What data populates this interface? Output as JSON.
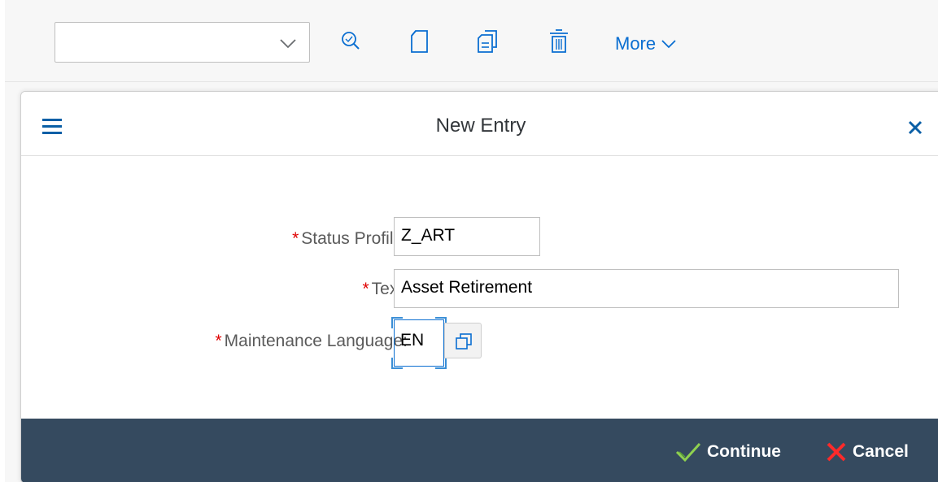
{
  "toolbar": {
    "combo_value": "",
    "more_label": "More",
    "icons": [
      "search-icon",
      "new-document-icon",
      "copy-icon",
      "delete-icon"
    ]
  },
  "dialog": {
    "title": "New Entry",
    "fields": {
      "status_profile": {
        "label": "Status Profile:",
        "value": "Z_ART",
        "required": "*"
      },
      "text": {
        "label": "Text:",
        "value": "Asset Retirement",
        "required": "*"
      },
      "maintenance_language": {
        "label": "Maintenance Language:",
        "value": "EN",
        "required": "*"
      }
    },
    "buttons": {
      "continue": "Continue",
      "cancel": "Cancel"
    }
  },
  "colors": {
    "accent": "#0a6ed1",
    "footer_bg": "#354a5f",
    "continue_check": "#8fd14f",
    "cancel_x": "#ff2a2a",
    "required": "#e00000"
  }
}
